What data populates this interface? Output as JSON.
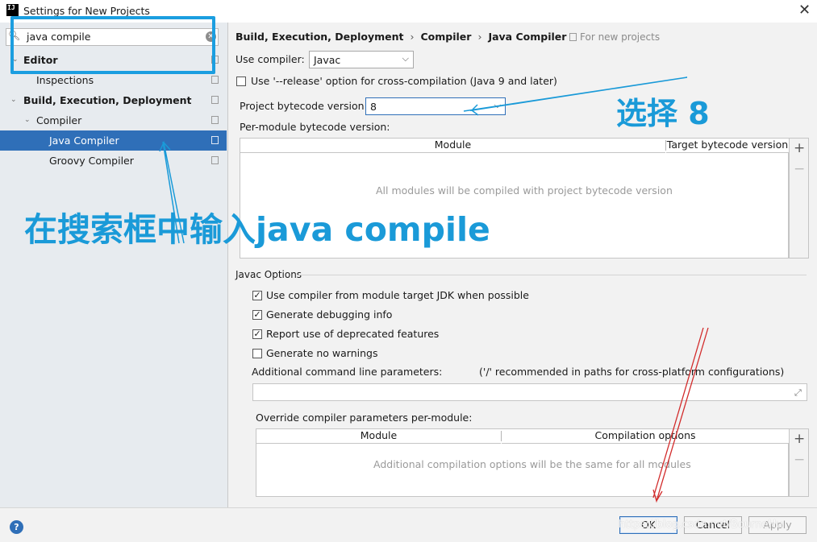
{
  "window": {
    "title": "Settings for New Projects",
    "app_icon": "IJ",
    "close_glyph": "✕"
  },
  "search": {
    "value": "java compile",
    "icon": "search-icon",
    "clear_glyph": "✕"
  },
  "tree": [
    {
      "label": "Editor",
      "bold": true,
      "arrow": "⌄"
    },
    {
      "label": "Inspections",
      "bold": false
    },
    {
      "label": "Build, Execution, Deployment",
      "bold": true,
      "arrow": "⌄"
    },
    {
      "label": "Compiler",
      "bold": false,
      "arrow": "⌄"
    },
    {
      "label": "Java Compiler",
      "bold": false,
      "selected": true
    },
    {
      "label": "Groovy Compiler",
      "bold": false
    }
  ],
  "breadcrumb": {
    "part1": "Build, Execution, Deployment",
    "part2": "Compiler",
    "part3": "Java Compiler",
    "sep": "›",
    "scope": "For new projects"
  },
  "compiler": {
    "use_compiler_label": "Use compiler:",
    "use_compiler_value": "Javac",
    "release_option_label": "Use '--release' option for cross-compilation (Java 9 and later)",
    "release_option_checked": false,
    "bytecode_label": "Project bytecode version:",
    "bytecode_value": "8",
    "per_module_label": "Per-module bytecode version:",
    "module_table": {
      "columns": [
        "Module",
        "Target bytecode version"
      ],
      "empty_text": "All modules will be compiled with project bytecode version"
    }
  },
  "javac": {
    "section_title": "Javac Options",
    "options": [
      {
        "label": "Use compiler from module target JDK when possible",
        "checked": true
      },
      {
        "label": "Generate debugging info",
        "checked": true
      },
      {
        "label": "Report use of deprecated features",
        "checked": true
      },
      {
        "label": "Generate no warnings",
        "checked": false
      }
    ],
    "cmd_label": "Additional command line parameters:",
    "cmd_hint": "('/' recommended in paths for cross-platform configurations)",
    "cmd_value": "",
    "override_label": "Override compiler parameters per-module:",
    "override_table": {
      "columns": [
        "Module",
        "Compilation options"
      ],
      "empty_text": "Additional compilation options will be the same for all modules"
    }
  },
  "table_buttons": {
    "add": "+",
    "remove": "−"
  },
  "buttons": {
    "ok": "OK",
    "cancel": "Cancel",
    "apply": "Apply",
    "help": "?"
  },
  "watermark": "https://blog.csdn.net/BourneHu",
  "annotations": {
    "select_8": "选择 8",
    "type_in_search": "在搜索框中输入java compile",
    "blue_color": "#1a9ad8",
    "red_color": "#d22b2b"
  }
}
